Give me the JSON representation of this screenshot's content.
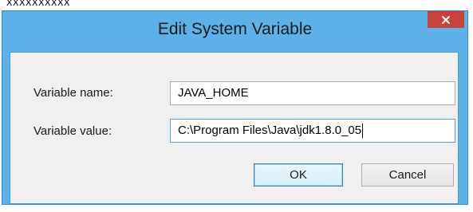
{
  "background": {
    "partial_text": "xxxxxxxxxx"
  },
  "dialog": {
    "title": "Edit System Variable",
    "close_icon": "close-x-icon",
    "name_label": "Variable name:",
    "name_value": "JAVA_HOME",
    "value_label": "Variable value:",
    "value_value": "C:\\Program Files\\Java\\jdk1.8.0_05",
    "ok_label": "OK",
    "cancel_label": "Cancel"
  },
  "colors": {
    "titlebar": "#5cb2e8",
    "close_button": "#c7433a",
    "client_bg": "#f0f0f0",
    "focus_border": "#569de5"
  }
}
